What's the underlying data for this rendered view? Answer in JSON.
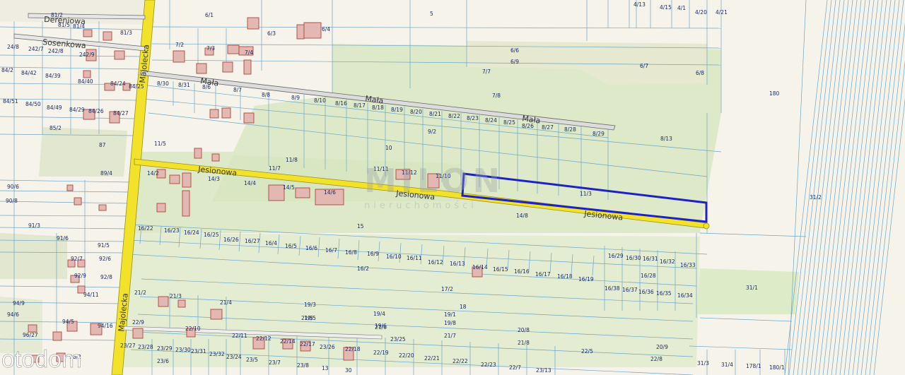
{
  "streets": [
    {
      "name": "Dereniowa",
      "key": "dereniowa"
    },
    {
      "name": "Sosenkowa",
      "key": "sosenkowa"
    },
    {
      "name": "Majolecka",
      "key": "majolecka-north"
    },
    {
      "name": "Majolecka",
      "key": "majolecka-south"
    },
    {
      "name": "Mała",
      "key": "mala-1"
    },
    {
      "name": "Mała",
      "key": "mala-2"
    },
    {
      "name": "Mała",
      "key": "mala-3"
    },
    {
      "name": "Jesionowa",
      "key": "jesionowa-1"
    },
    {
      "name": "Jesionowa",
      "key": "jesionowa-2"
    },
    {
      "name": "Jesionowa",
      "key": "jesionowa-3"
    }
  ],
  "parcel_labels": [
    "81/2",
    "81/5",
    "81/4",
    "81/3",
    "24/8",
    "242/7",
    "242/8",
    "242/9",
    "84/2",
    "84/42",
    "84/39",
    "84/40",
    "84/24",
    "84/25",
    "84/51",
    "84/50",
    "84/49",
    "84/29",
    "84/26",
    "84/27",
    "85/2",
    "87",
    "89/4",
    "90/6",
    "90/8",
    "91/3",
    "91/6",
    "91/5",
    "92/7",
    "92/6",
    "92/9",
    "92/8",
    "94/11",
    "94/9",
    "94/6",
    "94/5",
    "94/16",
    "96/27",
    "96/2",
    "6/1",
    "5",
    "6/3",
    "6/4",
    "7/2",
    "7/3",
    "7/4",
    "6/6",
    "6/9",
    "6/7",
    "6/8",
    "4/13",
    "4/15",
    "4/1",
    "4/20",
    "4/21",
    "7/7",
    "7/8",
    "8/30",
    "8/31",
    "8/6",
    "8/7",
    "8/8",
    "8/9",
    "8/10",
    "8/16",
    "8/17",
    "8/18",
    "8/19",
    "8/20",
    "8/21",
    "8/22",
    "8/23",
    "8/24",
    "8/25",
    "8/26",
    "8/27",
    "8/28",
    "8/29",
    "8/13",
    "9/2",
    "10",
    "11/5",
    "11/8",
    "11/7",
    "11/11",
    "11/12",
    "11/10",
    "11/3",
    "14/2",
    "14/3",
    "14/4",
    "14/5",
    "14/6",
    "15",
    "14/8",
    "16/22",
    "16/23",
    "16/24",
    "16/25",
    "16/26",
    "16/27",
    "16/4",
    "16/5",
    "16/6",
    "16/7",
    "16/8",
    "16/9",
    "16/10",
    "16/11",
    "16/12",
    "16/13",
    "16/14",
    "16/15",
    "16/16",
    "16/17",
    "16/18",
    "16/19",
    "16/29",
    "16/30",
    "16/31",
    "16/32",
    "16/33",
    "16/28",
    "16/38",
    "16/37",
    "16/36",
    "16/35",
    "16/34",
    "16/2",
    "17/2",
    "18",
    "19/3",
    "19/4",
    "19/1",
    "19/5",
    "19/6",
    "19/8",
    "20/8",
    "20/9",
    "21/2",
    "21/3",
    "21/4",
    "21/5",
    "21/6",
    "21/7",
    "21/8",
    "22/5",
    "22/8",
    "22/9",
    "22/10",
    "22/11",
    "22/12",
    "22/14",
    "22/17",
    "22/18",
    "22/19",
    "22/20",
    "22/21",
    "22/22",
    "22/23",
    "22/7",
    "23/13",
    "23/25",
    "23/26",
    "23/27",
    "23/28",
    "23/29",
    "23/30",
    "23/31",
    "23/32",
    "23/24",
    "23/5",
    "23/6",
    "23/7",
    "23/8",
    "13",
    "30",
    "180",
    "31/1",
    "31/2",
    "31/3",
    "31/4",
    "178/1",
    "180/1"
  ],
  "watermark_text": "MILON",
  "watermark_sub": "nieruchomości",
  "logo": "otodom",
  "colors": {
    "background": "#f6f3ea",
    "green_area": "#dde9c8",
    "road": "#f2e32a",
    "road_edge": "#9a8f1a",
    "highlight": "#1c22c8",
    "parcel_line": "#6aa6c8",
    "building_fill": "#e3b7b2",
    "building_stroke": "#a9483c",
    "label": "#1a2a6a"
  }
}
